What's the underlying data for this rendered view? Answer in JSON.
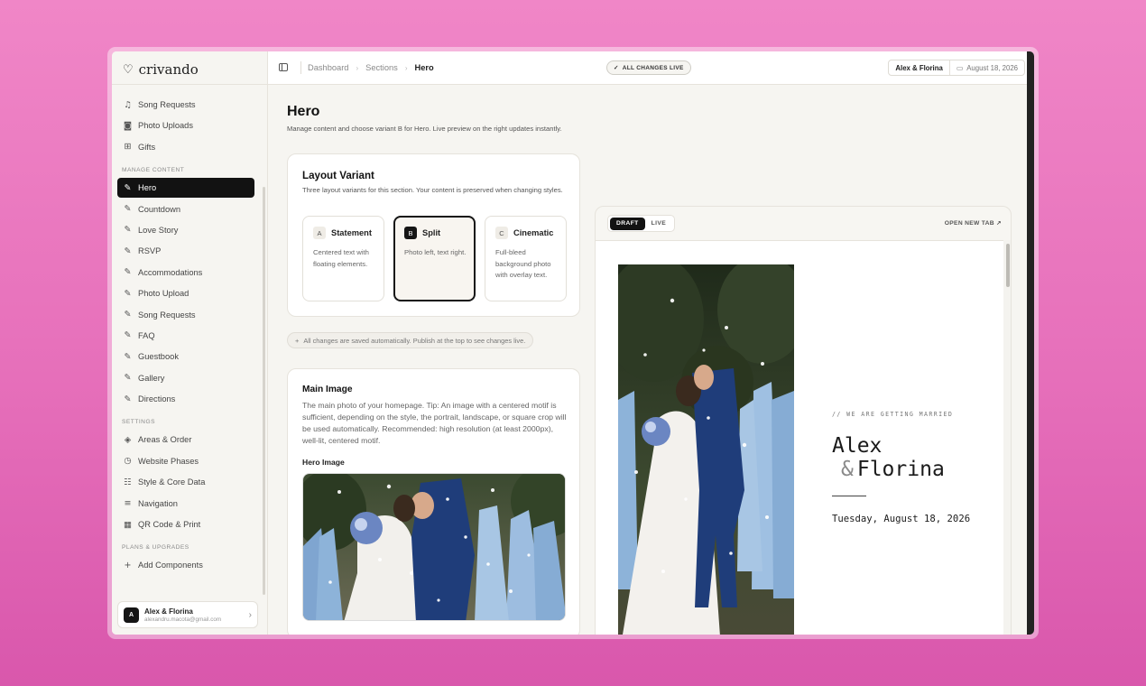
{
  "app": {
    "logo_text": "crivando"
  },
  "sidebar": {
    "items_top": [
      {
        "label": "Song Requests",
        "icon": "music-icon",
        "glyph": "♫"
      },
      {
        "label": "Photo Uploads",
        "icon": "camera-icon",
        "glyph": "◙"
      },
      {
        "label": "Gifts",
        "icon": "gift-icon",
        "glyph": "⊞"
      }
    ],
    "manage_heading": "MANAGE CONTENT",
    "manage_items": [
      {
        "label": "Hero",
        "active": true
      },
      {
        "label": "Countdown"
      },
      {
        "label": "Love Story"
      },
      {
        "label": "RSVP"
      },
      {
        "label": "Accommodations"
      },
      {
        "label": "Photo Upload"
      },
      {
        "label": "Song Requests"
      },
      {
        "label": "FAQ"
      },
      {
        "label": "Guestbook"
      },
      {
        "label": "Gallery"
      },
      {
        "label": "Directions"
      }
    ],
    "settings_heading": "SETTINGS",
    "settings_items": [
      {
        "label": "Areas & Order",
        "icon": "layers-icon",
        "glyph": "◈"
      },
      {
        "label": "Website Phases",
        "icon": "clock-icon",
        "glyph": "◷"
      },
      {
        "label": "Style & Core Data",
        "icon": "sliders-icon",
        "glyph": "☷"
      },
      {
        "label": "Navigation",
        "icon": "menu-icon",
        "glyph": "≡"
      },
      {
        "label": "QR Code & Print",
        "icon": "qr-code-icon",
        "glyph": "▦"
      }
    ],
    "plans_heading": "PLANS & UPGRADES",
    "plans_items": [
      {
        "label": "Add Components",
        "icon": "plus-icon",
        "glyph": "+"
      }
    ],
    "user": {
      "initial": "A",
      "name": "Alex & Florina",
      "email": "alexandru.macota@gmail.com"
    }
  },
  "topbar": {
    "breadcrumbs": [
      "Dashboard",
      "Sections",
      "Hero"
    ],
    "status_label": "ALL CHANGES LIVE",
    "couple_name": "Alex & Florina",
    "event_date": "August 18, 2026"
  },
  "page": {
    "title": "Hero",
    "subtitle": "Manage content and choose variant B for Hero. Live preview on the right updates instantly."
  },
  "layout_variant": {
    "title": "Layout Variant",
    "description": "Three layout variants for this section. Your content is preserved when changing styles.",
    "selected": "B",
    "options": [
      {
        "letter": "A",
        "name": "Statement",
        "desc": "Centered text with floating elements."
      },
      {
        "letter": "B",
        "name": "Split",
        "desc": "Photo left, text right."
      },
      {
        "letter": "C",
        "name": "Cinematic",
        "desc": "Full-bleed background photo with overlay text."
      }
    ]
  },
  "notice": "All changes are saved automatically. Publish at the top to see changes live.",
  "main_image": {
    "title": "Main Image",
    "description": "The main photo of your homepage. Tip: An image with a centered motif is sufficient, depending on the style, the portrait, landscape, or square crop will be used automatically. Recommended: high resolution (at least 2000px), well-lit, centered motif.",
    "field_label": "Hero Image"
  },
  "preview": {
    "tabs": [
      "DRAFT",
      "LIVE"
    ],
    "active_tab": "DRAFT",
    "open_new_tab": "OPEN NEW TAB",
    "tagline": "// WE ARE GETTING MARRIED",
    "name_first": "Alex",
    "name_amp": "&",
    "name_second": "Florina",
    "date": "Tuesday, August 18, 2026"
  }
}
